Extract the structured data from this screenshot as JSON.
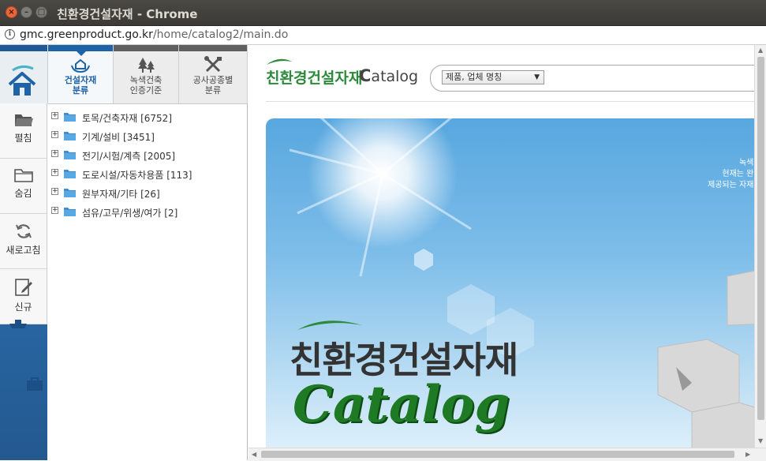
{
  "window": {
    "title": "친환경건설자재 - Chrome"
  },
  "address": {
    "host": "gmc.greenproduct.go.kr",
    "path": "/home/catalog2/main.do"
  },
  "iconbar": {
    "home_icon": "home-icon",
    "tools": [
      {
        "label": "펼침",
        "icon": "folder-open-icon"
      },
      {
        "label": "숨김",
        "icon": "folder-icon"
      },
      {
        "label": "새로고침",
        "icon": "refresh-icon"
      },
      {
        "label": "신규",
        "icon": "new-document-icon"
      }
    ]
  },
  "category_tabs": [
    {
      "line1": "건설자재",
      "line2": "분류",
      "active": true
    },
    {
      "line1": "녹색건축",
      "line2": "인증기준",
      "active": false
    },
    {
      "line1": "공사공종별",
      "line2": "분류",
      "active": false
    }
  ],
  "tree": [
    {
      "label": "토목/건축자재 [6752]"
    },
    {
      "label": "기계/설비 [3451]"
    },
    {
      "label": "전기/시험/계측 [2005]"
    },
    {
      "label": "도로시설/자동차용품 [113]"
    },
    {
      "label": "원부자재/기타 [26]"
    },
    {
      "label": "섬유/고무/위생/여가 [2]"
    }
  ],
  "header": {
    "logo_kr": "친환경건설자재",
    "logo_catalog_initial": "C",
    "logo_catalog_rest": "atalog",
    "search_select": "제품, 업체 명칭"
  },
  "banner": {
    "title_kr": "친환경건설자재",
    "title_en": "Catalog",
    "side_line1": "녹색",
    "side_line2": "현재는 완",
    "side_line3": "제공되는 자재"
  },
  "colors": {
    "accent": "#1e63a8",
    "brand_green": "#2c8a3a",
    "iconbar": "#2a67a5"
  }
}
